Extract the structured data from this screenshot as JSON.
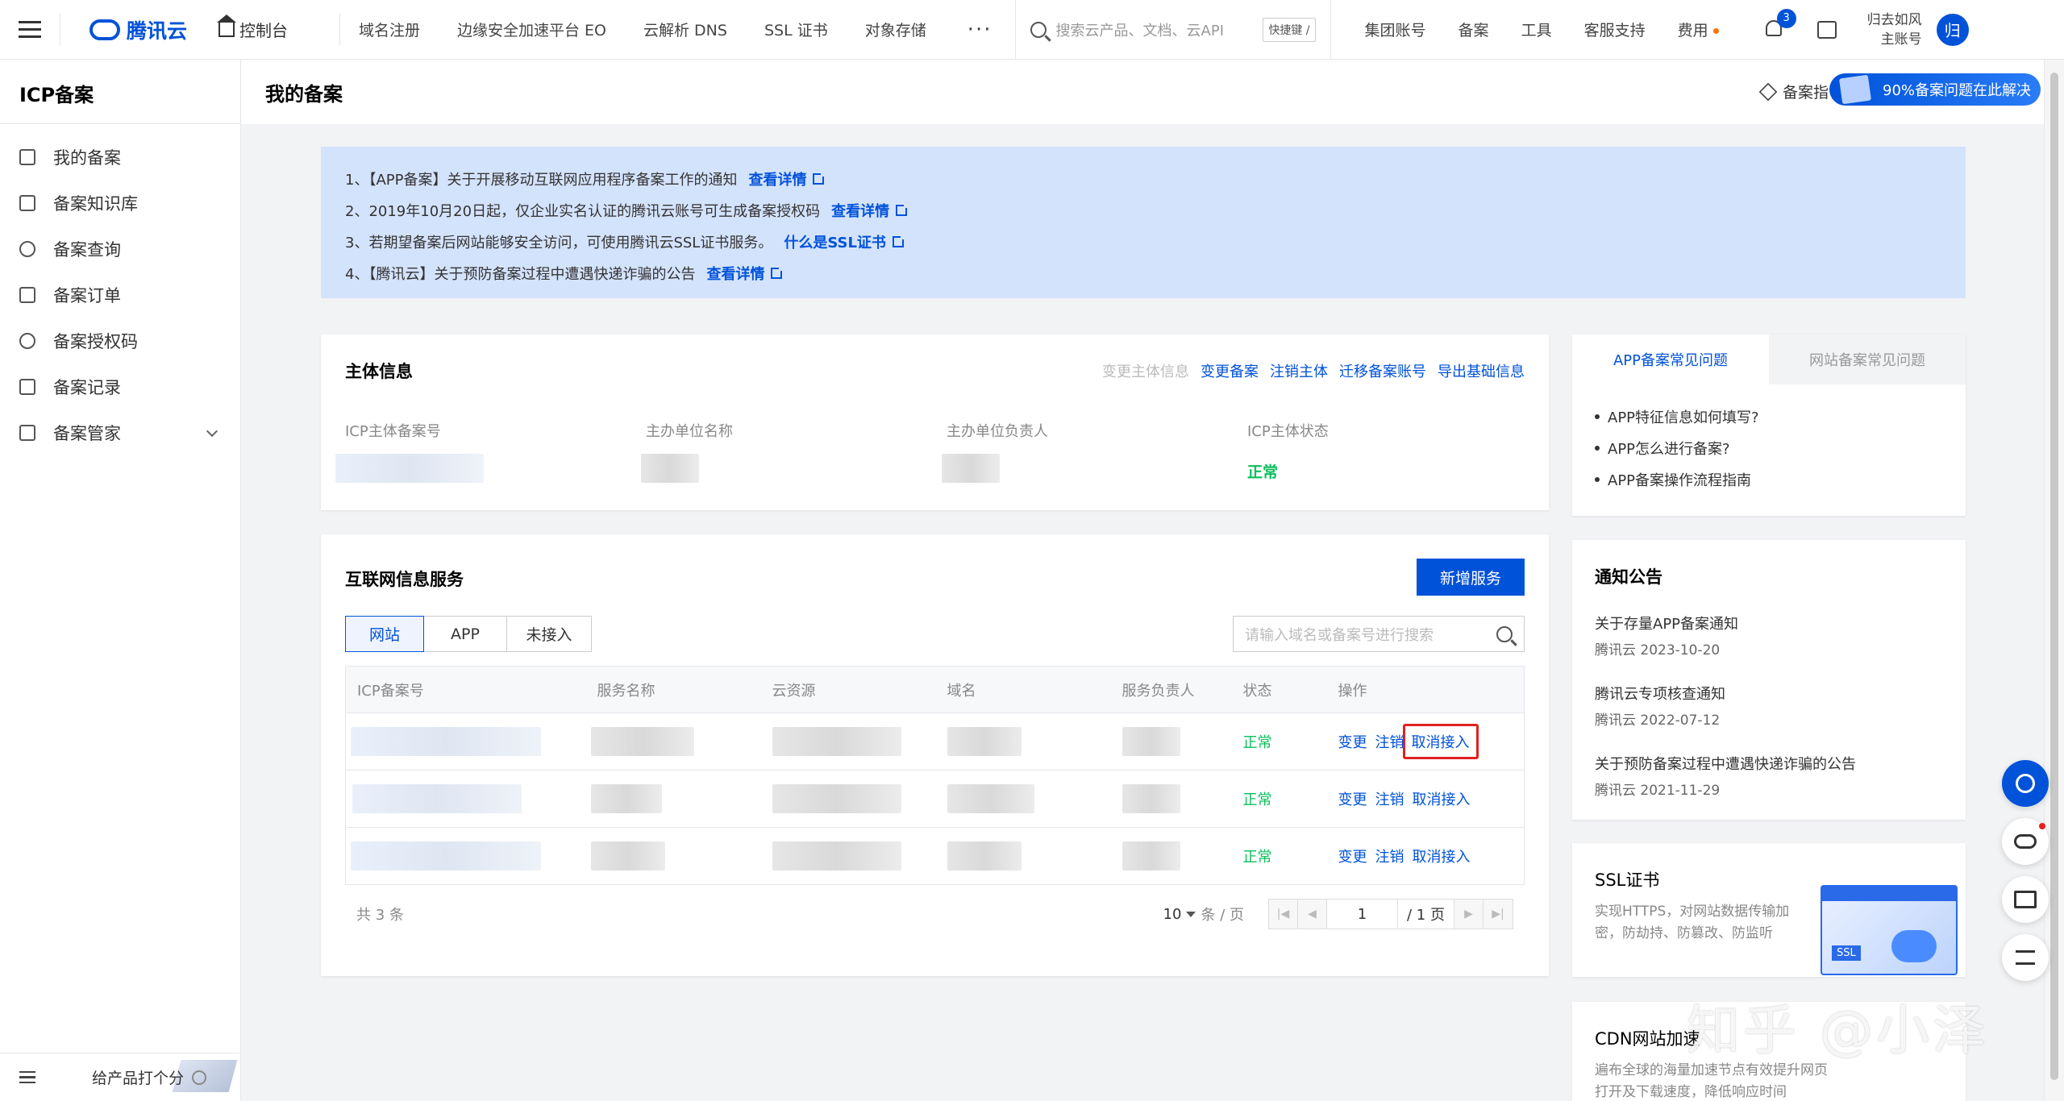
{
  "topbar": {
    "brand": "腾讯云",
    "console": "控制台",
    "nav": [
      "域名注册",
      "边缘安全加速平台 EO",
      "云解析 DNS",
      "SSL 证书",
      "对象存储"
    ],
    "more": "···",
    "search_placeholder": "搜索云产品、文档、云API",
    "shortcut": "快捷键 /",
    "right_links": [
      "集团账号",
      "备案",
      "工具",
      "客服支持",
      "费用"
    ],
    "notification_count": "3",
    "account_line1": "归去如风",
    "account_line2": "主账号",
    "avatar_text": "归"
  },
  "sidebar": {
    "title": "ICP备案",
    "items": [
      {
        "label": "我的备案",
        "icon": "bookmark-icon"
      },
      {
        "label": "备案知识库",
        "icon": "library-icon"
      },
      {
        "label": "备案查询",
        "icon": "search-icon"
      },
      {
        "label": "备案订单",
        "icon": "checklist-icon"
      },
      {
        "label": "备案授权码",
        "icon": "number-one-icon"
      },
      {
        "label": "备案记录",
        "icon": "record-icon"
      },
      {
        "label": "备案管家",
        "icon": "download-box-icon"
      }
    ],
    "feedback": "给产品打个分"
  },
  "page": {
    "title": "我的备案",
    "guide": "备案指引",
    "promo": "90%备案问题在此解决"
  },
  "notices": [
    {
      "text": "1、【APP备案】关于开展移动互联网应用程序备案工作的通知",
      "link": "查看详情"
    },
    {
      "text": "2、2019年10月20日起，仅企业实名认证的腾讯云账号可生成备案授权码",
      "link": "查看详情"
    },
    {
      "text": "3、若期望备案后网站能够安全访问，可使用腾讯云SSL证书服务。",
      "link": "什么是SSL证书"
    },
    {
      "text": "4、【腾讯云】关于预防备案过程中遭遇快递诈骗的公告",
      "link": "查看详情"
    }
  ],
  "subject": {
    "title": "主体信息",
    "actions": [
      "变更主体信息",
      "变更备案",
      "注销主体",
      "迁移备案账号",
      "导出基础信息"
    ],
    "fields": [
      {
        "label": "ICP主体备案号"
      },
      {
        "label": "主办单位名称"
      },
      {
        "label": "主办单位负责人"
      },
      {
        "label": "ICP主体状态",
        "value": "正常"
      }
    ]
  },
  "service": {
    "title": "互联网信息服务",
    "add_button": "新增服务",
    "tabs": [
      "网站",
      "APP",
      "未接入"
    ],
    "search_placeholder": "请输入域名或备案号进行搜索",
    "columns": [
      "ICP备案号",
      "服务名称",
      "云资源",
      "域名",
      "服务负责人",
      "状态",
      "操作"
    ],
    "rows": [
      {
        "status": "正常",
        "ops": [
          "变更",
          "注销",
          "取消接入"
        ]
      },
      {
        "status": "正常",
        "ops": [
          "变更",
          "注销",
          "取消接入"
        ]
      },
      {
        "status": "正常",
        "ops": [
          "变更",
          "注销",
          "取消接入"
        ]
      }
    ],
    "total": "共 3 条",
    "page_size": "10",
    "page_size_unit": "条 / 页",
    "current_page": "1",
    "total_pages": "/ 1 页"
  },
  "faq": {
    "tabs": [
      "APP备案常见问题",
      "网站备案常见问题"
    ],
    "items": [
      "APP特征信息如何填写?",
      "APP怎么进行备案?",
      "APP备案操作流程指南"
    ]
  },
  "announcements": {
    "title": "通知公告",
    "items": [
      {
        "title": "关于存量APP备案通知",
        "meta": "腾讯云 2023-10-20"
      },
      {
        "title": "腾讯云专项核查通知",
        "meta": "腾讯云 2022-07-12"
      },
      {
        "title": "关于预防备案过程中遭遇快递诈骗的公告",
        "meta": "腾讯云 2021-11-29"
      }
    ]
  },
  "ssl_card": {
    "title": "SSL证书",
    "desc": "实现HTTPS，对网站数据传输加密，防劫持、防篡改、防监听",
    "art_text": "SSL"
  },
  "cdn_card": {
    "title": "CDN网站加速",
    "desc": "遍布全球的海量加速节点有效提升网页打开及下载速度，降低响应时间"
  },
  "watermark": "知乎 @小泽"
}
